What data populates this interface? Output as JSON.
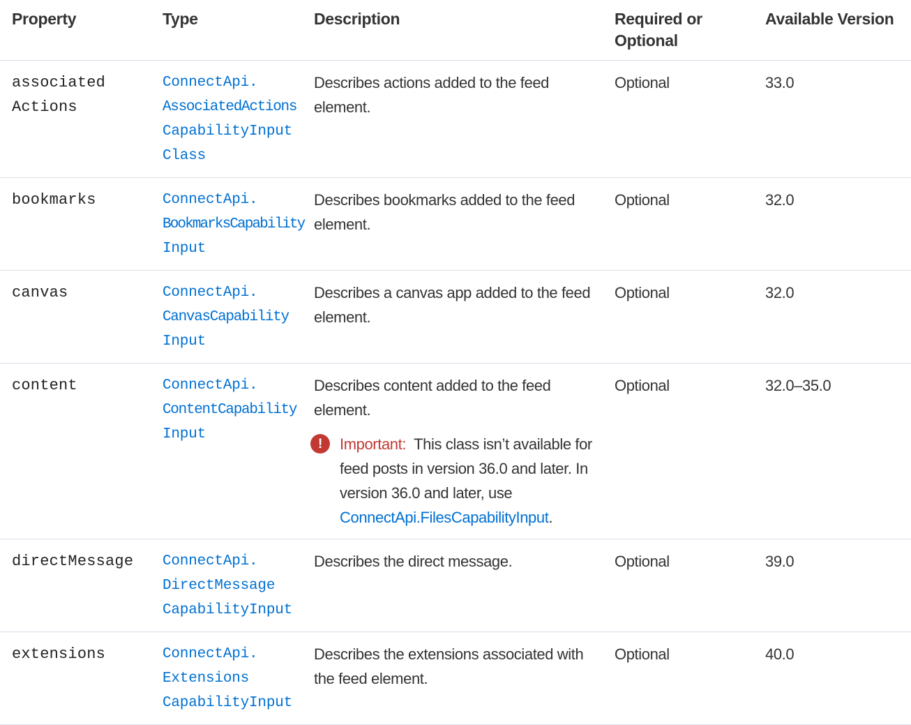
{
  "headers": {
    "property": "Property",
    "type": "Type",
    "description": "Description",
    "required_line1": "Required or",
    "required_line2": "Optional",
    "version": "Available Version"
  },
  "rows": [
    {
      "property_line1": "associated",
      "property_line2": "Actions",
      "type_lines": [
        "ConnectApi.",
        "AssociatedActions",
        "CapabilityInput",
        "Class"
      ],
      "description": "Describes actions added to the feed element.",
      "required": "Optional",
      "version": "33.0"
    },
    {
      "property_line1": "bookmarks",
      "type_lines": [
        "ConnectApi.",
        "BookmarksCapability",
        "Input"
      ],
      "description": "Describes bookmarks added to the feed element.",
      "required": "Optional",
      "version": "32.0"
    },
    {
      "property_line1": "canvas",
      "type_lines": [
        "ConnectApi.",
        "CanvasCapability",
        "Input"
      ],
      "description": "Describes a canvas app added to the feed element.",
      "required": "Optional",
      "version": "32.0"
    },
    {
      "property_line1": "content",
      "type_lines": [
        "ConnectApi.",
        "ContentCapability",
        "Input"
      ],
      "description": "Describes content added to the feed element.",
      "important": {
        "icon": "!",
        "label": "Important:",
        "text": "This class isn’t available for feed posts in version 36.0 and later. In version 36.0 and later, use",
        "link": "ConnectApi.FilesCapabilityInput",
        "after": "."
      },
      "required": "Optional",
      "version": "32.0–35.0"
    },
    {
      "property_line1": "directMessage",
      "type_lines": [
        "ConnectApi.",
        "DirectMessage",
        "CapabilityInput"
      ],
      "description": "Describes the direct message.",
      "required": "Optional",
      "version": "39.0"
    },
    {
      "property_line1": "extensions",
      "type_lines": [
        "ConnectApi.",
        "Extensions",
        "CapabilityInput"
      ],
      "description": "Describes the extensions associated with the feed element.",
      "required": "Optional",
      "version": "40.0"
    }
  ],
  "colors": {
    "link": "#0070d2",
    "important": "#c23934",
    "border": "#d8dde6",
    "text": "#333333"
  }
}
